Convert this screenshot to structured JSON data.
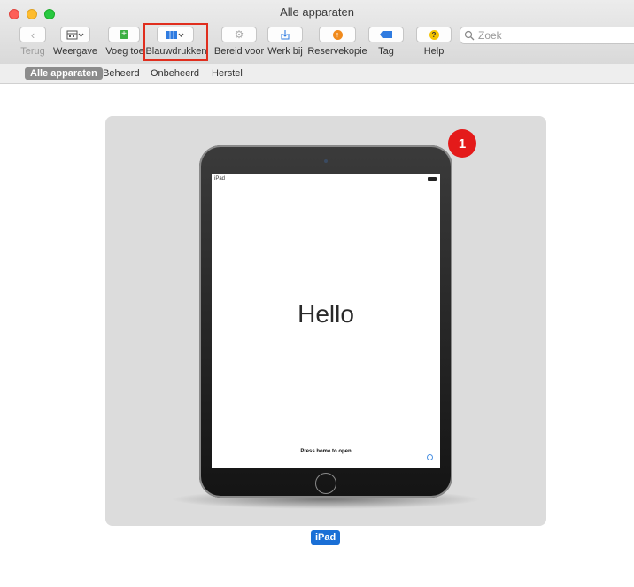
{
  "window": {
    "title": "Alle apparaten"
  },
  "toolbar": {
    "back_label": "Terug",
    "view_label": "Weergave",
    "add_label": "Voeg toe",
    "blueprints_label": "Blauwdrukken",
    "prepare_label": "Bereid voor",
    "update_label": "Werk bij",
    "backup_label": "Reservekopie",
    "tag_label": "Tag",
    "help_label": "Help",
    "search_placeholder": "Zoek"
  },
  "scope": [
    "Alle apparaten",
    "Beheerd",
    "Onbeheerd",
    "Herstel"
  ],
  "device": {
    "name": "iPad",
    "status_label": "iPad",
    "greeting": "Hello",
    "prompt": "Press home to open",
    "badge": "1"
  },
  "colors": {
    "highlight": "#e02e1e",
    "badge": "#e41a1a",
    "selection": "#1a6fd6"
  }
}
